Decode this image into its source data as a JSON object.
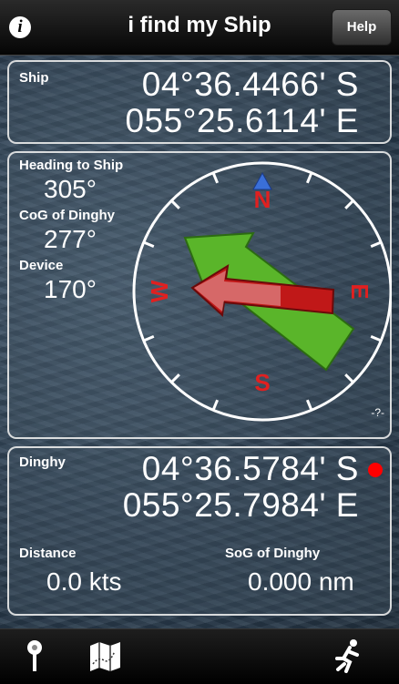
{
  "header": {
    "title": "i find my Ship",
    "info_icon": "i",
    "help_label": "Help"
  },
  "ship": {
    "label": "Ship",
    "lat": "04°36.4466' S",
    "lon": "055°25.6114' E"
  },
  "compass": {
    "heading_label": "Heading to Ship",
    "heading_value": "305°",
    "cog_label": "CoG of Dinghy",
    "cog_value": "277°",
    "device_label": "Device",
    "device_value": "170°",
    "n": "N",
    "e": "E",
    "s": "S",
    "w": "W",
    "corner_note": "-?-",
    "colors": {
      "cardinal": "#e02020",
      "north_marker": "#3a6fd8",
      "green_arrow": "#5ab52a",
      "red_arrow": "#c01818"
    }
  },
  "dinghy": {
    "label": "Dinghy",
    "lat": "04°36.5784' S",
    "lon": "055°25.7984' E",
    "status_dot_color": "#ff0000",
    "distance_label": "Distance",
    "distance_value": "0.0 kts",
    "sog_label": "SoG of Dinghy",
    "sog_value": "0.000 nm"
  },
  "toolbar": {
    "icons": [
      "pin-icon",
      "map-icon",
      "runner-icon"
    ]
  }
}
